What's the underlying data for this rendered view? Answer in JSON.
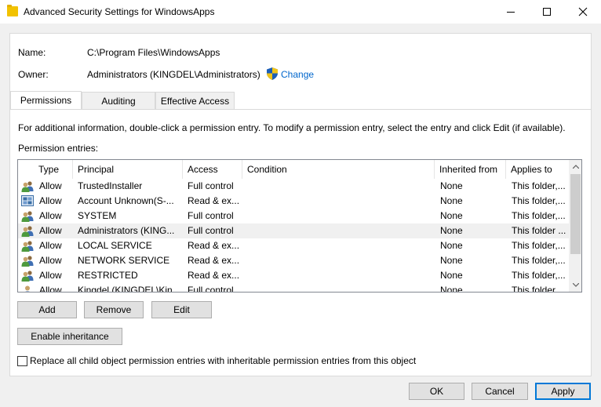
{
  "window": {
    "title": "Advanced Security Settings for WindowsApps"
  },
  "name_field": {
    "label": "Name:",
    "value": "C:\\Program Files\\WindowsApps"
  },
  "owner_field": {
    "label": "Owner:",
    "value": "Administrators (KINGDEL\\Administrators)",
    "change_label": "Change"
  },
  "tabs": [
    {
      "label": "Permissions",
      "active": true
    },
    {
      "label": "Auditing",
      "active": false
    },
    {
      "label": "Effective Access",
      "active": false
    }
  ],
  "info_text": "For additional information, double-click a permission entry. To modify a permission entry, select the entry and click Edit (if available).",
  "entries_label": "Permission entries:",
  "columns": [
    "Type",
    "Principal",
    "Access",
    "Condition",
    "Inherited from",
    "Applies to"
  ],
  "rows": [
    {
      "icon": "group-icon",
      "type": "Allow",
      "principal": "TrustedInstaller",
      "access": "Full control",
      "condition": "",
      "inherited": "None",
      "applies": "This folder,..."
    },
    {
      "icon": "unknown-account-icon",
      "type": "Allow",
      "principal": "Account Unknown(S-...",
      "access": "Read & ex...",
      "condition": "",
      "inherited": "None",
      "applies": "This folder,..."
    },
    {
      "icon": "group-icon",
      "type": "Allow",
      "principal": "SYSTEM",
      "access": "Full control",
      "condition": "",
      "inherited": "None",
      "applies": "This folder,..."
    },
    {
      "icon": "group-icon",
      "type": "Allow",
      "principal": "Administrators (KING...",
      "access": "Full control",
      "condition": "",
      "inherited": "None",
      "applies": "This folder ..."
    },
    {
      "icon": "group-icon",
      "type": "Allow",
      "principal": "LOCAL SERVICE",
      "access": "Read & ex...",
      "condition": "",
      "inherited": "None",
      "applies": "This folder,..."
    },
    {
      "icon": "group-icon",
      "type": "Allow",
      "principal": "NETWORK SERVICE",
      "access": "Read & ex...",
      "condition": "",
      "inherited": "None",
      "applies": "This folder,..."
    },
    {
      "icon": "group-icon",
      "type": "Allow",
      "principal": "RESTRICTED",
      "access": "Read & ex...",
      "condition": "",
      "inherited": "None",
      "applies": "This folder,..."
    },
    {
      "icon": "user-icon",
      "type": "Allow",
      "principal": "Kingdel (KINGDEL\\Kin...",
      "access": "Full control",
      "condition": "",
      "inherited": "None",
      "applies": "This folder ..."
    }
  ],
  "list_buttons": {
    "add": "Add",
    "remove": "Remove",
    "edit": "Edit"
  },
  "enable_inheritance_label": "Enable inheritance",
  "replace_checkbox_label": "Replace all child object permission entries with inheritable permission entries from this object",
  "replace_checked": false,
  "dialog_buttons": {
    "ok": "OK",
    "cancel": "Cancel",
    "apply": "Apply"
  }
}
